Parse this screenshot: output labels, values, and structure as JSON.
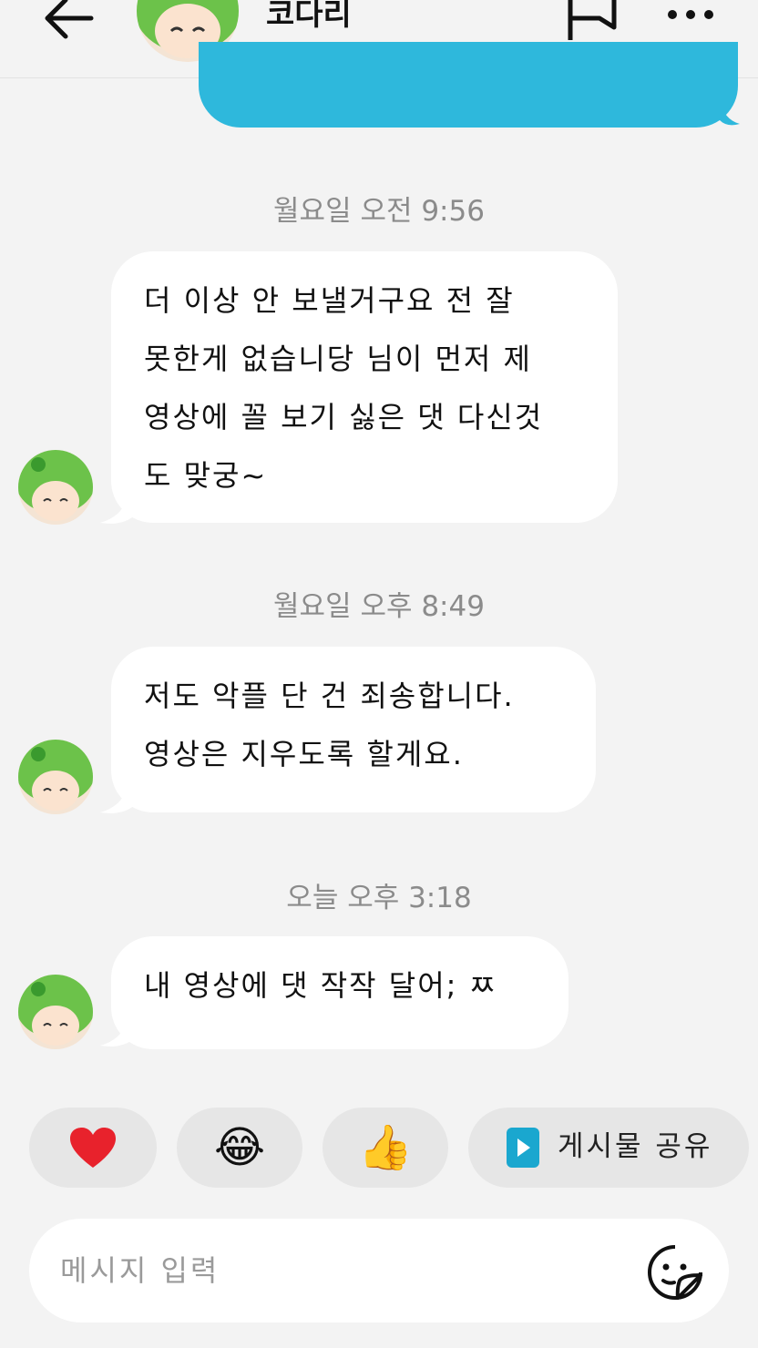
{
  "header": {
    "back_icon": "arrow-left-icon",
    "title": "코다리",
    "flag_icon": "flag-icon",
    "more_icon": "more-horizontal-icon"
  },
  "messages": [
    {
      "timestamp": "월요일 오전 9:56",
      "text": "더 이상 안 보낼거구요 전 잘\n못한게 없습니당 님이 먼저 제\n영상에 꼴 보기 싫은 댓 다신것\n도 맞궁~"
    },
    {
      "timestamp": "월요일 오후 8:49",
      "text": "저도 악플 단 건 죄송합니다.\n영상은 지우도록 할게요."
    },
    {
      "timestamp": "오늘 오후 3:18",
      "text": "내 영상에 댓 작작 달어; ㅉ"
    }
  ],
  "reactions": {
    "heart": "❤️",
    "laugh": "😂",
    "thumbs_up": "👍",
    "share_label": "게시물 공유",
    "share_icon": "play-icon"
  },
  "composer": {
    "placeholder": "메시지 입력",
    "sticker_icon": "sticker-icon"
  },
  "colors": {
    "background": "#f3f3f3",
    "sent_bubble": "#2eb8dc",
    "received_bubble": "#ffffff",
    "timestamp": "#8b8b8b",
    "share_icon": "#1aa7cf",
    "heart": "#e8222c"
  }
}
